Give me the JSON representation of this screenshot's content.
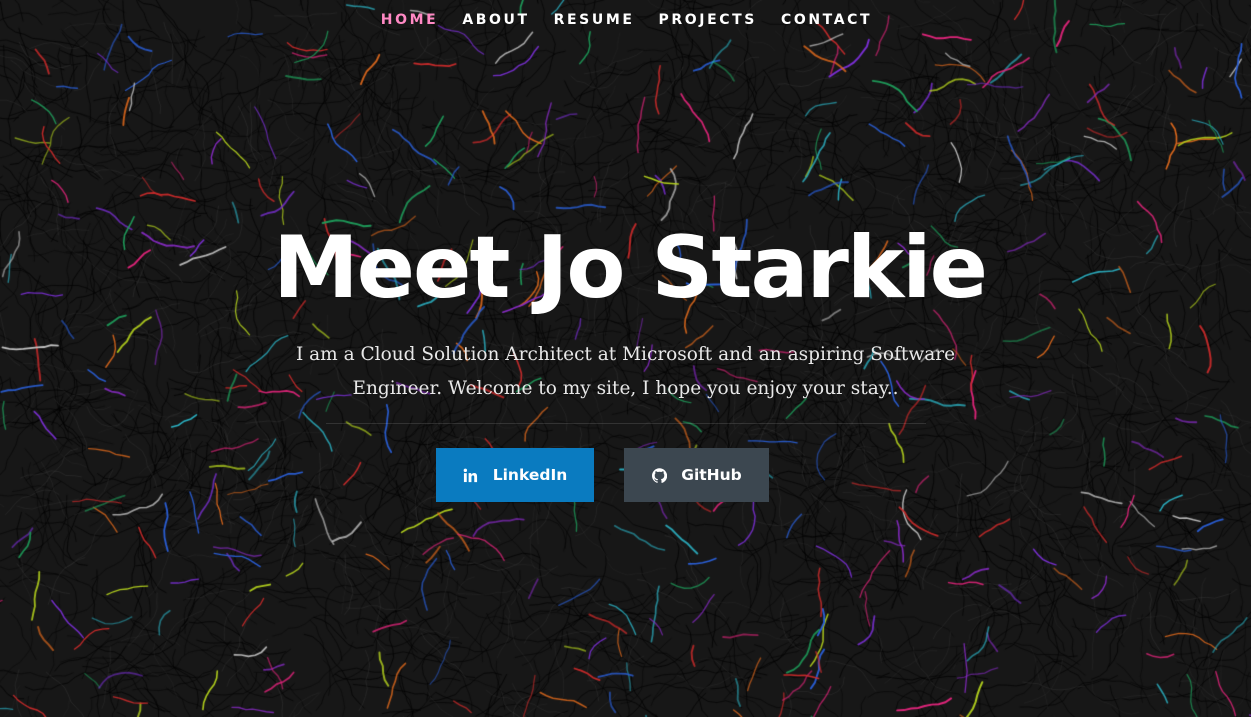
{
  "nav": {
    "items": [
      {
        "label": "HOME",
        "active": true
      },
      {
        "label": "ABOUT",
        "active": false
      },
      {
        "label": "RESUME",
        "active": false
      },
      {
        "label": "PROJECTS",
        "active": false
      },
      {
        "label": "CONTACT",
        "active": false
      }
    ]
  },
  "hero": {
    "title": "Meet Jo Starkie",
    "subtitle": "I am a Cloud Solution Architect at Microsoft and an aspiring Software Engineer. Welcome to my site, I hope you enjoy your stay.."
  },
  "buttons": {
    "linkedin": {
      "label": "LinkedIn",
      "icon": "linkedin-icon"
    },
    "github": {
      "label": "GitHub",
      "icon": "github-icon"
    }
  },
  "colors": {
    "background": "#171717",
    "nav_active": "#ff89c4",
    "linkedin_bg": "#0a7bc0",
    "github_bg": "#3c4750",
    "strand_palette": [
      "#e0247a",
      "#2bb2c4",
      "#7a2fd4",
      "#b5d31d",
      "#e26a1c",
      "#1e9c5a",
      "#d12b2b",
      "#2a5fd8",
      "#c4c4c4",
      "#8a2bc9"
    ]
  }
}
